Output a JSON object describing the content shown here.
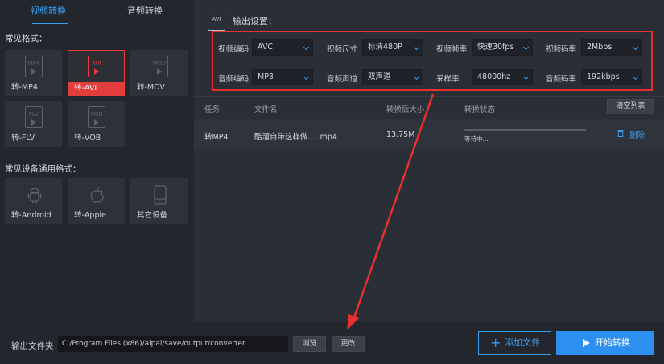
{
  "tabs": {
    "video": "视频转换",
    "audio": "音频转换"
  },
  "left": {
    "common_formats_title": "常见格式：",
    "device_formats_title": "常见设备通用格式：",
    "formats": [
      {
        "icon_text": "MP4",
        "label": "转-MP4"
      },
      {
        "icon_text": "AVI",
        "label": "转-AVI"
      },
      {
        "icon_text": "MOV",
        "label": "转-MOV"
      },
      {
        "icon_text": "FLV",
        "label": "转-FLV"
      },
      {
        "icon_text": "VOB",
        "label": "转-VOB"
      }
    ],
    "selected_format": "AVI",
    "devices": [
      {
        "icon": "android-icon",
        "label": "转-Android"
      },
      {
        "icon": "apple-icon",
        "label": "转-Apple"
      },
      {
        "icon": "phone-icon",
        "label": "其它设备"
      }
    ]
  },
  "output": {
    "icon_text": "AVI",
    "title": "输出设置：",
    "settings": {
      "video_codec_label": "视频编码",
      "video_codec": "AVC",
      "video_size_label": "视频尺寸",
      "video_size": "标清480P",
      "frame_rate_label": "视频帧率",
      "frame_rate": "快速30fps",
      "video_bitrate_label": "视频码率",
      "video_bitrate": "2Mbps",
      "audio_codec_label": "音频编码",
      "audio_codec": "MP3",
      "audio_channel_label": "音频声道",
      "audio_channel": "双声道",
      "sample_rate_label": "采样率",
      "sample_rate": "48000hz",
      "audio_bitrate_label": "音频码率",
      "audio_bitrate": "192kbps"
    }
  },
  "table": {
    "headers": {
      "task": "任务",
      "filename": "文件名",
      "size": "转换后大小",
      "status": "转换状态"
    },
    "clear_label": "清空列表",
    "rows": [
      {
        "task": "转MP4",
        "filename": "酷溜自带这样做... .mp4",
        "size": "13.75M",
        "status": "等待中...",
        "progress": 0,
        "delete_label": "删除"
      }
    ]
  },
  "bottom": {
    "folder_label": "输出文件夹",
    "path": "C:/Program Files (x86)/aipai/save/output/converter",
    "browse_label": "浏览",
    "change_label": "更改",
    "add_file_label": "添加文件",
    "start_label": "开始转换"
  },
  "colors": {
    "accent": "#2d8ff0",
    "selected": "#e33d3d",
    "annotation": "#e8312e"
  }
}
